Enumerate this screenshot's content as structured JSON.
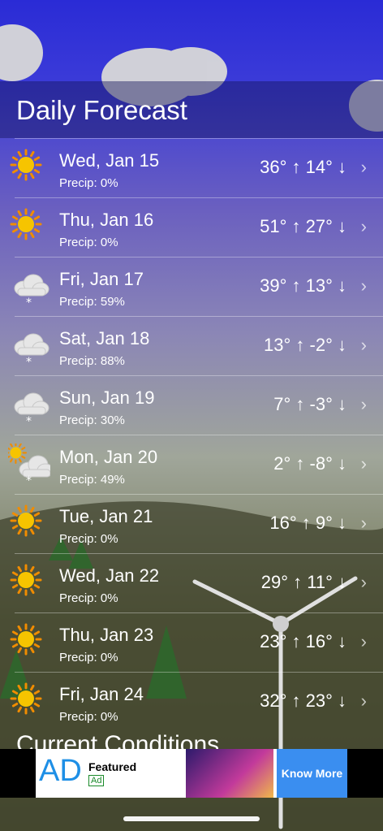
{
  "header": {
    "title": "Daily Forecast"
  },
  "forecast": [
    {
      "day": "Wed, Jan 15",
      "precip": "Precip: 0%",
      "temps": "36° ↑  14° ↓",
      "icon": "sun-icon"
    },
    {
      "day": "Thu, Jan 16",
      "precip": "Precip: 0%",
      "temps": "51° ↑  27° ↓",
      "icon": "sun-icon"
    },
    {
      "day": "Fri, Jan 17",
      "precip": "Precip: 59%",
      "temps": "39° ↑  13° ↓",
      "icon": "snow-cloud-icon"
    },
    {
      "day": "Sat, Jan 18",
      "precip": "Precip: 88%",
      "temps": "13° ↑  -2° ↓",
      "icon": "snow-cloud-icon"
    },
    {
      "day": "Sun, Jan 19",
      "precip": "Precip: 30%",
      "temps": "7° ↑  -3° ↓",
      "icon": "snow-cloud-icon"
    },
    {
      "day": "Mon, Jan 20",
      "precip": "Precip: 49%",
      "temps": "2° ↑  -8° ↓",
      "icon": "partly-cloudy-snow-icon"
    },
    {
      "day": "Tue, Jan 21",
      "precip": "Precip: 0%",
      "temps": "16° ↑  9° ↓",
      "icon": "sun-icon"
    },
    {
      "day": "Wed, Jan 22",
      "precip": "Precip: 0%",
      "temps": "29° ↑  11° ↓",
      "icon": "sun-icon"
    },
    {
      "day": "Thu, Jan 23",
      "precip": "Precip: 0%",
      "temps": "23° ↑  16° ↓",
      "icon": "sun-icon"
    },
    {
      "day": "Fri, Jan 24",
      "precip": "Precip: 0%",
      "temps": "32° ↑  23° ↓",
      "icon": "sun-icon"
    }
  ],
  "chevron": "›",
  "current_conditions": {
    "title": "Current Conditions"
  },
  "ad": {
    "logo": "AD",
    "featured": "Featured",
    "tag": "Ad",
    "cta": "Know More"
  }
}
